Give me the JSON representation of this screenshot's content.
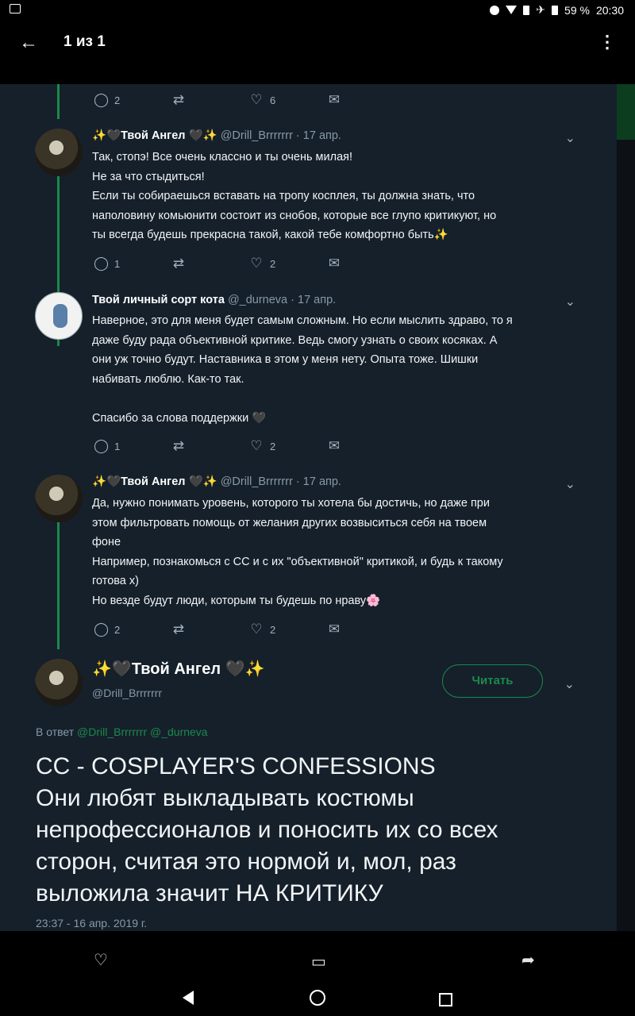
{
  "statusbar": {
    "battery": "59 %",
    "time": "20:30"
  },
  "appbar": {
    "title": "1 из 1"
  },
  "tweets": [
    {
      "actions": {
        "replies": "2",
        "retweets": "",
        "likes": "6"
      }
    },
    {
      "name": "Твой Ангел",
      "handle": "@Drill_Brrrrrrr · 17 апр.",
      "lines": [
        "Так, стопэ! Все очень классно и ты очень милая!",
        "Не за что стыдиться!",
        "Если ты собираешься вставать на тропу косплея, ты должна знать, что",
        "наполовину комьюнити состоит из снобов, которые все глупо критикуют, но",
        "ты всегда будешь прекрасна такой, какой тебе комфортно быть✨"
      ],
      "actions": {
        "replies": "1",
        "retweets": "",
        "likes": "2"
      }
    },
    {
      "name": "Твой личный сорт кота",
      "handle": "@_durneva · 17 апр.",
      "lines": [
        "Наверное, это для меня будет самым сложным. Но если мыслить здраво, то я",
        "даже буду рада объективной критике. Ведь смогу узнать о своих косяках. А",
        "они уж точно будут. Наставника в этом у меня нету. Опыта тоже. Шишки",
        "набивать люблю. Как-то так.",
        "",
        "Спасибо за слова поддержки 🖤"
      ],
      "actions": {
        "replies": "1",
        "retweets": "",
        "likes": "2"
      }
    },
    {
      "name": "Твой Ангел",
      "handle": "@Drill_Brrrrrrr · 17 апр.",
      "lines": [
        "Да, нужно понимать уровень, которого ты хотела бы достичь, но даже при",
        "этом фильтровать помощь от желания других возвыситься себя на твоем",
        "фоне",
        "Например, познакомься с СС и с их \"объективной\" критикой, и будь к такому",
        "готова х)",
        "Но везде будут люди, которым ты будешь по нраву🌸"
      ],
      "actions": {
        "replies": "2",
        "retweets": "",
        "likes": "2"
      }
    }
  ],
  "main_tweet": {
    "name": "Твой Ангел",
    "handle": "@Drill_Brrrrrrr",
    "follow_label": "Читать",
    "reply_prefix": "В ответ",
    "reply_users": "@Drill_Brrrrrrr @_durneva",
    "lines": [
      "CC - COSPLAYER'S CONFESSIONS",
      "Они любят выкладывать костюмы",
      "непрофессионалов и поносить их со всех",
      "сторон, считая это нормой и, мол, раз",
      "выложила значит НА КРИТИКУ"
    ],
    "timestamp": "23:37 - 16 апр. 2019 г."
  },
  "icons": {
    "reply": "reply-icon",
    "retweet": "retweet-icon",
    "like": "heart-icon",
    "dm": "mail-icon"
  }
}
